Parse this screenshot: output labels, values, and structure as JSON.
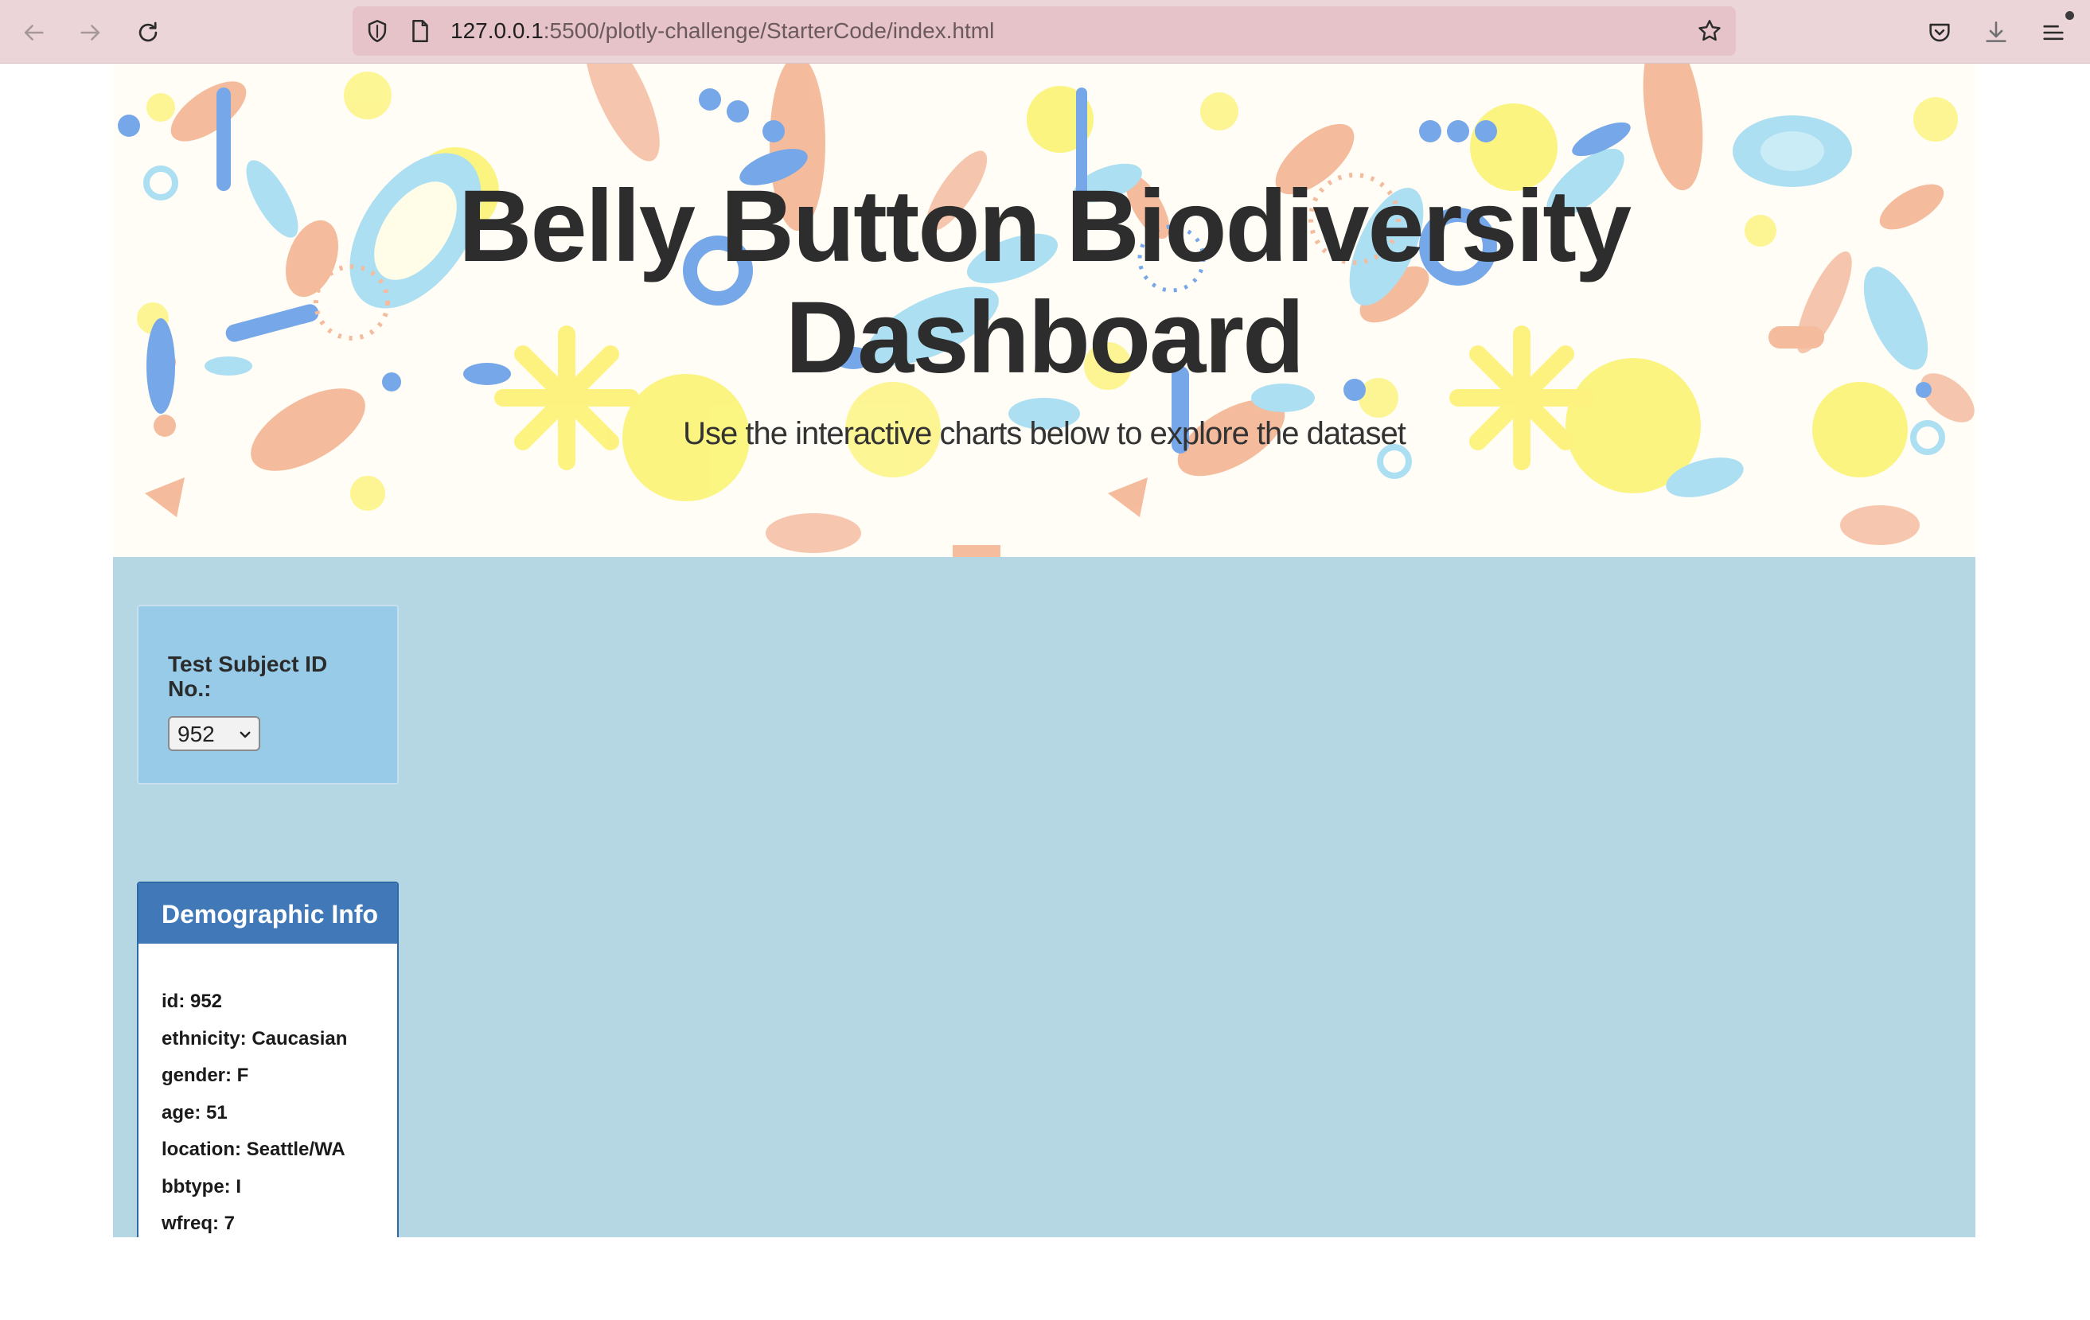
{
  "browser": {
    "url_host": "127.0.0.1",
    "url_rest": ":5500/plotly-challenge/StarterCode/index.html"
  },
  "header": {
    "title_line1": "Belly Button Biodiversity",
    "title_line2": "Dashboard",
    "subtitle": "Use the interactive charts below to explore the dataset"
  },
  "selector": {
    "label": "Test Subject ID No.:",
    "selected_value": "952"
  },
  "demographics": {
    "title": "Demographic Info",
    "lines": [
      "id: 952",
      "ethnicity: Caucasian",
      "gender: F",
      "age: 51",
      "location: Seattle/WA",
      "bbtype: I",
      "wfreq: 7"
    ]
  },
  "colors": {
    "toolbar": "#ecd5d9",
    "urlbar": "#e6c3c8",
    "content_bg": "#b4d7e3",
    "selector_bg": "#97cbe8",
    "panel_header": "#4178b8"
  }
}
